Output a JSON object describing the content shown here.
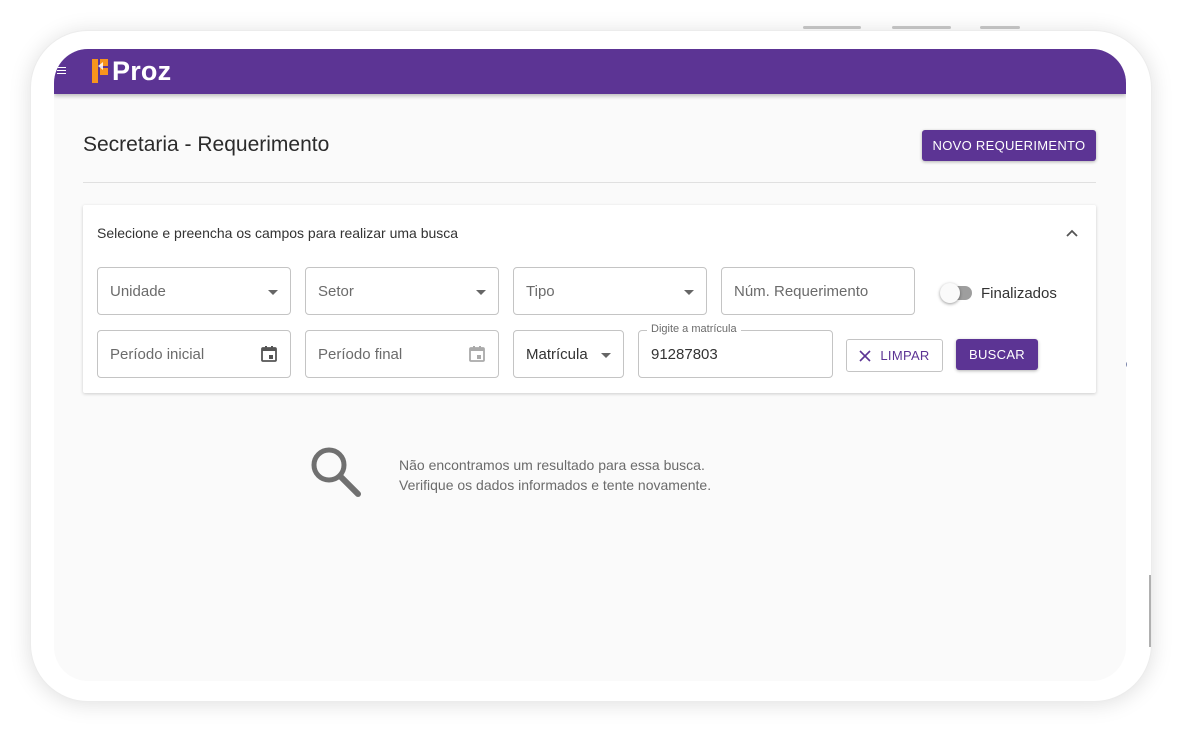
{
  "app": {
    "logo_text": "Proz",
    "brand_color": "#5c3494",
    "logo_accent": "#f7941d"
  },
  "header": {
    "page_title": "Secretaria - Requerimento",
    "new_button_label": "NOVO REQUERIMENTO"
  },
  "search_panel": {
    "hint": "Selecione e preencha os campos para realizar uma busca",
    "collapse_icon": "chevron-up-icon",
    "fields": {
      "unidade": "Unidade",
      "setor": "Setor",
      "tipo": "Tipo",
      "num_requerimento": "Núm. Requerimento",
      "periodo_inicial": "Período inicial",
      "periodo_final": "Período final",
      "matricula_select": "Matrícula",
      "matricula_label": "Digite a matrícula",
      "matricula_value": "91287803"
    },
    "toggle": {
      "label": "Finalizados",
      "checked": false
    },
    "clear_label": "LIMPAR",
    "search_label": "BUSCAR"
  },
  "empty_state": {
    "icon": "search-icon",
    "line1": "Não encontramos um resultado para essa busca.",
    "line2": "Verifique os dados informados e tente novamente."
  }
}
